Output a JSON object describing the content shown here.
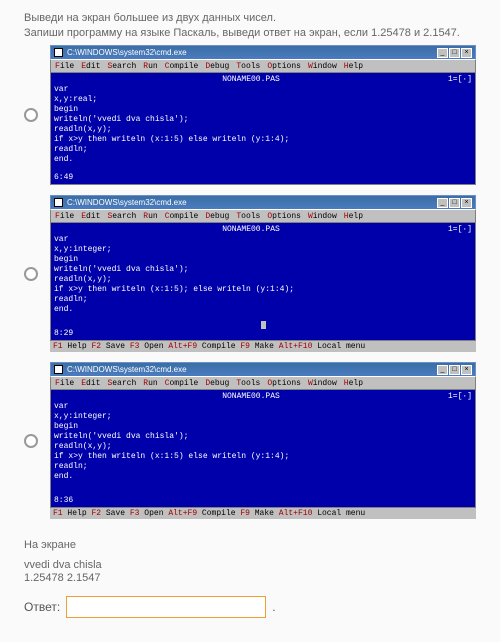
{
  "question": {
    "line1": "Выведи на экран большее из двух данных чисел.",
    "line2": "Запиши программу на языке Паскаль, выведи ответ на экран, если 1.25478 и 2.1547."
  },
  "window": {
    "title_path": "C:\\WINDOWS\\system32\\cmd.exe",
    "btn_min": "_",
    "btn_max": "□",
    "btn_close": "×"
  },
  "menubar": {
    "items": [
      "File",
      "Edit",
      "Search",
      "Run",
      "Compile",
      "Debug",
      "Tools",
      "Options",
      "Window",
      "Help"
    ]
  },
  "options": [
    {
      "title_center": "NONAME00.PAS",
      "code": "var\nx,y:real;\nbegin\nwriteln('vvedi dva chisla');\nreadln(x,y);\nif x>y then writeln (x:1:5) else writeln (y:1:4);\nreadln;\nend.",
      "time": "6:49",
      "has_statusbar": false,
      "right_marker": "1=[·]"
    },
    {
      "title_center": "NONAME00.PAS",
      "code": "var\nx,y:integer;\nbegin\nwriteln('vvedi dva chisla');\nreadln(x,y);\nif x>y then writeln (x:1:5); else writeln (y:1:4);\nreadln;\nend.",
      "time": "8:29",
      "has_statusbar": true,
      "right_marker": "1=[·]"
    },
    {
      "title_center": "NONAME00.PAS",
      "code": "var\nx,y:integer;\nbegin\nwriteln('vvedi dva chisla');\nreadln(x,y);\nif x>y then writeln (x:1:5) else writeln (y:1:4);\nreadln;\nend.",
      "time": "8:36",
      "has_statusbar": true,
      "right_marker": "1=[·]"
    }
  ],
  "statusbar": "F1 Help  F2 Save  F3 Open  Alt+F9 Compile  F9 Make  Alt+F10 Local menu",
  "screen": {
    "heading": "На экране",
    "line1": "vvedi dva chisla",
    "line2": "1.25478 2.1547"
  },
  "answer": {
    "label": "Ответ:",
    "value": "",
    "placeholder": "",
    "period": "."
  }
}
